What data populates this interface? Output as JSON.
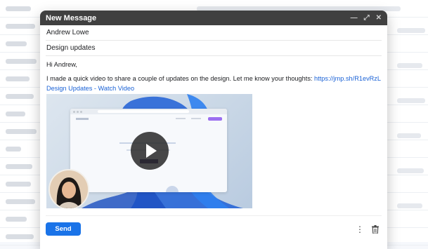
{
  "compose": {
    "title": "New Message",
    "to": "Andrew Lowe",
    "subject": "Design updates",
    "greeting": "Hi Andrew,",
    "message": "I made a quick video to share a couple of updates on the design. Let me know your thoughts:",
    "link": "https://jmp.sh/R1evRzL",
    "video_title": "Design Updates - Watch Video",
    "send_label": "Send"
  },
  "colors": {
    "titlebar": "#404040",
    "accent": "#1a73e8",
    "link": "#1a62d6"
  }
}
